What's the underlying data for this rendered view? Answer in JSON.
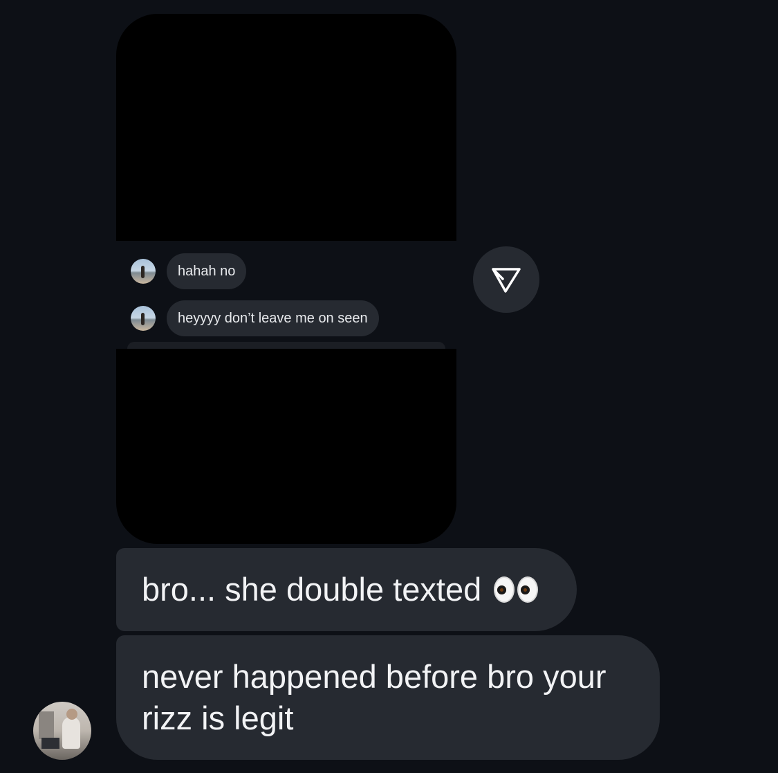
{
  "shared_post": {
    "replies": [
      {
        "text": "hahah no"
      },
      {
        "text": "heyyyy don’t leave me on seen"
      }
    ],
    "share_icon": "send-arrow-icon"
  },
  "messages": [
    {
      "text": "bro... she double texted",
      "emoji": "eyes"
    },
    {
      "text": "never happened before bro your rizz is legit"
    }
  ],
  "colors": {
    "background": "#0d1016",
    "bubble": "#262a31",
    "text": "#f2f3f5"
  }
}
